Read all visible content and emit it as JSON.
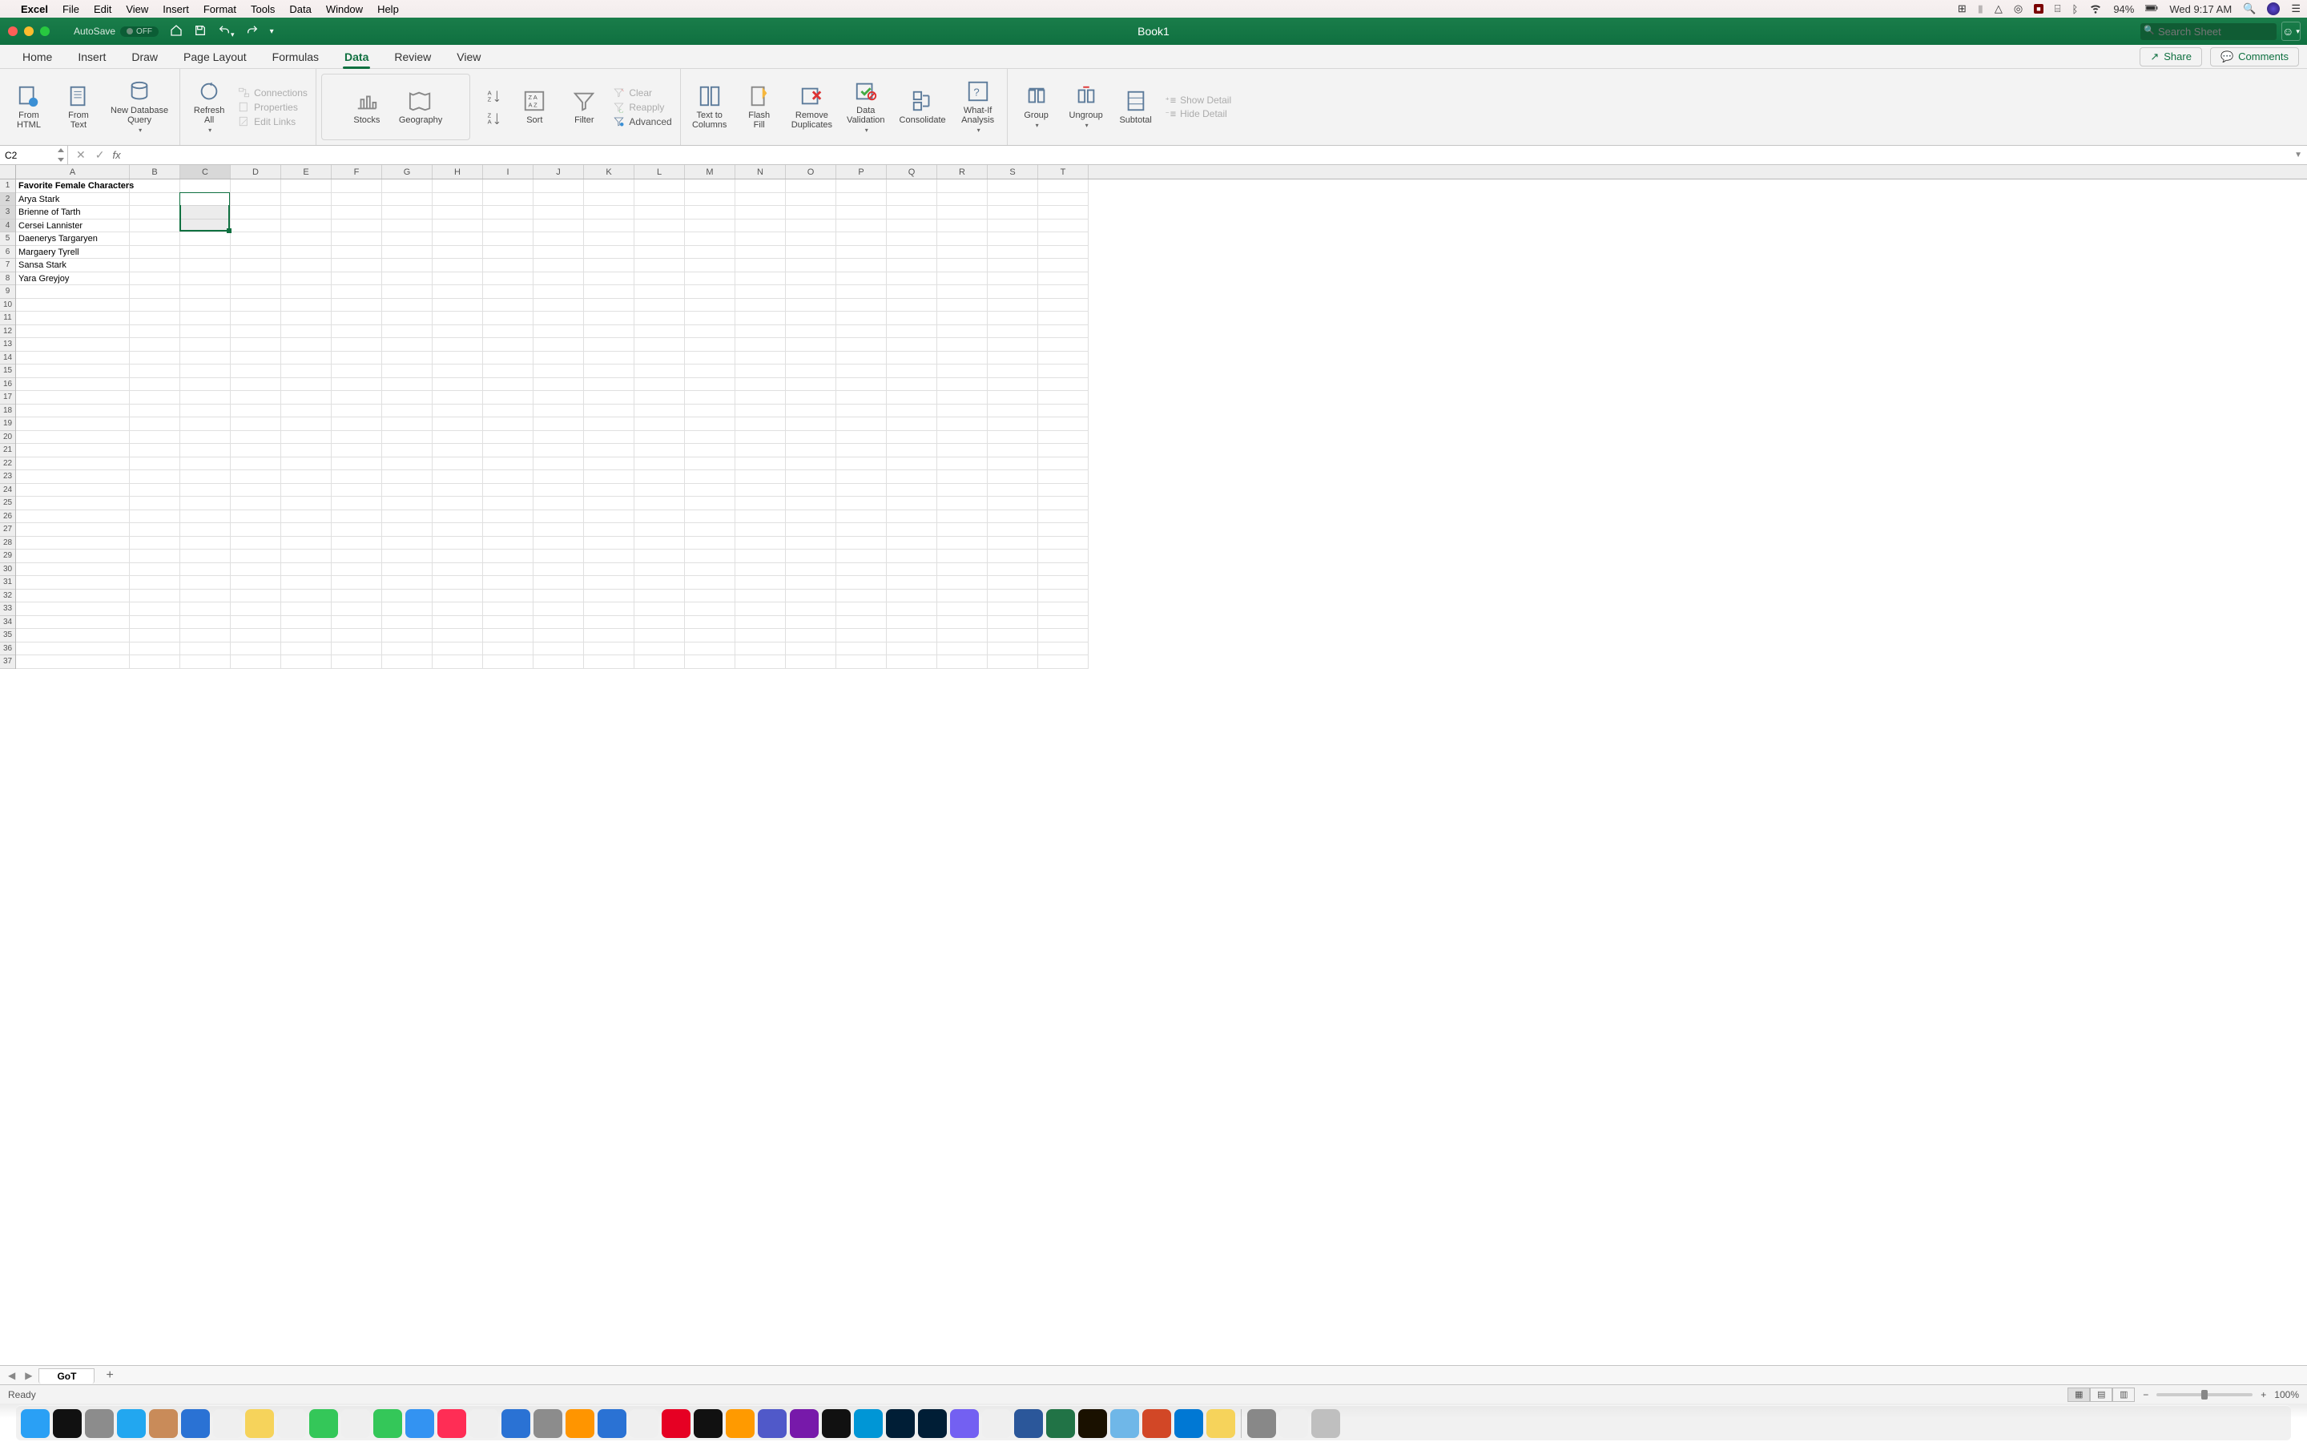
{
  "mac_menu": {
    "app": "Excel",
    "items": [
      "File",
      "Edit",
      "View",
      "Insert",
      "Format",
      "Tools",
      "Data",
      "Window",
      "Help"
    ],
    "battery": "94%",
    "clock": "Wed 9:17 AM"
  },
  "titlebar": {
    "autosave_label": "AutoSave",
    "autosave_state": "OFF",
    "title": "Book1",
    "search_placeholder": "Search Sheet"
  },
  "ribbon_tabs": {
    "tabs": [
      "Home",
      "Insert",
      "Draw",
      "Page Layout",
      "Formulas",
      "Data",
      "Review",
      "View"
    ],
    "active": "Data",
    "share": "Share",
    "comments": "Comments"
  },
  "ribbon": {
    "from_html": "From\nHTML",
    "from_text": "From\nText",
    "new_db_query": "New Database\nQuery",
    "refresh_all": "Refresh\nAll",
    "connections": "Connections",
    "properties": "Properties",
    "edit_links": "Edit Links",
    "stocks": "Stocks",
    "geography": "Geography",
    "sort": "Sort",
    "filter": "Filter",
    "clear": "Clear",
    "reapply": "Reapply",
    "advanced": "Advanced",
    "text_to_columns": "Text to\nColumns",
    "flash_fill": "Flash\nFill",
    "remove_duplicates": "Remove\nDuplicates",
    "data_validation": "Data\nValidation",
    "consolidate": "Consolidate",
    "what_if": "What-If\nAnalysis",
    "group": "Group",
    "ungroup": "Ungroup",
    "subtotal": "Subtotal",
    "show_detail": "Show Detail",
    "hide_detail": "Hide Detail"
  },
  "formula_bar": {
    "name_box": "C2",
    "fx": "fx",
    "value": ""
  },
  "grid": {
    "columns": [
      "A",
      "B",
      "C",
      "D",
      "E",
      "F",
      "G",
      "H",
      "I",
      "J",
      "K",
      "L",
      "M",
      "N",
      "O",
      "P",
      "Q",
      "R",
      "S",
      "T"
    ],
    "col_widths": {
      "A": 142,
      "default": 63
    },
    "rows_visible": 37,
    "selection": {
      "ref": "C2:C4",
      "col_start": "C",
      "row_start": 2,
      "col_end": "C",
      "row_end": 4
    },
    "data": {
      "A1": {
        "v": "Favorite Female Characters",
        "bold": true
      },
      "A2": {
        "v": "Arya Stark"
      },
      "A3": {
        "v": "Brienne of Tarth"
      },
      "A4": {
        "v": "Cersei Lannister"
      },
      "A5": {
        "v": "Daenerys Targaryen"
      },
      "A6": {
        "v": "Margaery Tyrell"
      },
      "A7": {
        "v": "Sansa Stark"
      },
      "A8": {
        "v": "Yara Greyjoy"
      }
    }
  },
  "sheet_tabs": {
    "tabs": [
      "GoT"
    ],
    "active": "GoT"
  },
  "statusbar": {
    "status": "Ready",
    "zoom": "100%"
  },
  "dock_apps": [
    {
      "n": "finder",
      "c": "#2aa0f5"
    },
    {
      "n": "siri",
      "c": "#111"
    },
    {
      "n": "launchpad",
      "c": "#8c8c8c"
    },
    {
      "n": "safari",
      "c": "#22a7f0"
    },
    {
      "n": "contacts",
      "c": "#c98b59"
    },
    {
      "n": "preview",
      "c": "#2a72d4"
    },
    {
      "n": "reminders",
      "c": "#efefef"
    },
    {
      "n": "notes",
      "c": "#f6d35b"
    },
    {
      "n": "calendar",
      "c": "#efefef"
    },
    {
      "n": "messages",
      "c": "#34c759"
    },
    {
      "n": "photos",
      "c": "#efefef"
    },
    {
      "n": "facetime",
      "c": "#34c759"
    },
    {
      "n": "mail",
      "c": "#3393f2"
    },
    {
      "n": "itunes",
      "c": "#ff2d55"
    },
    {
      "n": "numbers",
      "c": "#efefef"
    },
    {
      "n": "keynote",
      "c": "#2a72d4"
    },
    {
      "n": "automator",
      "c": "#8c8c8c"
    },
    {
      "n": "books",
      "c": "#ff9500"
    },
    {
      "n": "appstore",
      "c": "#2a72d4"
    },
    {
      "n": "chrome",
      "c": "#efefef"
    },
    {
      "n": "pinterest",
      "c": "#e60023"
    },
    {
      "n": "wondershare",
      "c": "#111"
    },
    {
      "n": "illustrator",
      "c": "#ff9a00"
    },
    {
      "n": "teams",
      "c": "#5059c9"
    },
    {
      "n": "onenote",
      "c": "#7719aa"
    },
    {
      "n": "wacom",
      "c": "#111"
    },
    {
      "n": "hp",
      "c": "#0096d6"
    },
    {
      "n": "photoshop",
      "c": "#001e36"
    },
    {
      "n": "lightroom",
      "c": "#001e36"
    },
    {
      "n": "viber",
      "c": "#7360f2"
    },
    {
      "n": "slack",
      "c": "#efefef"
    },
    {
      "n": "word",
      "c": "#2b579a"
    },
    {
      "n": "excel",
      "c": "#217346"
    },
    {
      "n": "bridge",
      "c": "#1a1100"
    },
    {
      "n": "folder",
      "c": "#6fb7e8"
    },
    {
      "n": "powerpoint",
      "c": "#d24726"
    },
    {
      "n": "outlook",
      "c": "#0078d4"
    },
    {
      "n": "stickies",
      "c": "#f6d35b"
    },
    {
      "n": "app1",
      "c": "#888"
    },
    {
      "n": "chrome2",
      "c": "#efefef"
    },
    {
      "n": "trash",
      "c": "#bfbfbf"
    }
  ]
}
